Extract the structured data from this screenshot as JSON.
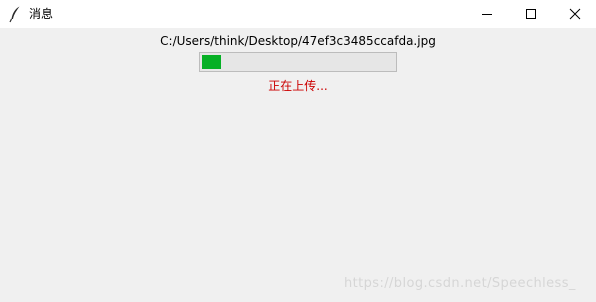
{
  "window": {
    "title": "消息",
    "icon": "feather-icon",
    "controls": {
      "minimize_icon": "minimize-icon",
      "maximize_icon": "maximize-icon",
      "close_icon": "close-icon"
    }
  },
  "upload": {
    "file_path": "C:/Users/think/Desktop/47ef3c3485ccafda.jpg",
    "progress": 0.1,
    "status": "正在上传..."
  },
  "watermark": "https://blog.csdn.net/Speechless_",
  "colors": {
    "progress_fill": "#06b025",
    "status_text": "#cc0000",
    "background": "#f0f0f0"
  }
}
